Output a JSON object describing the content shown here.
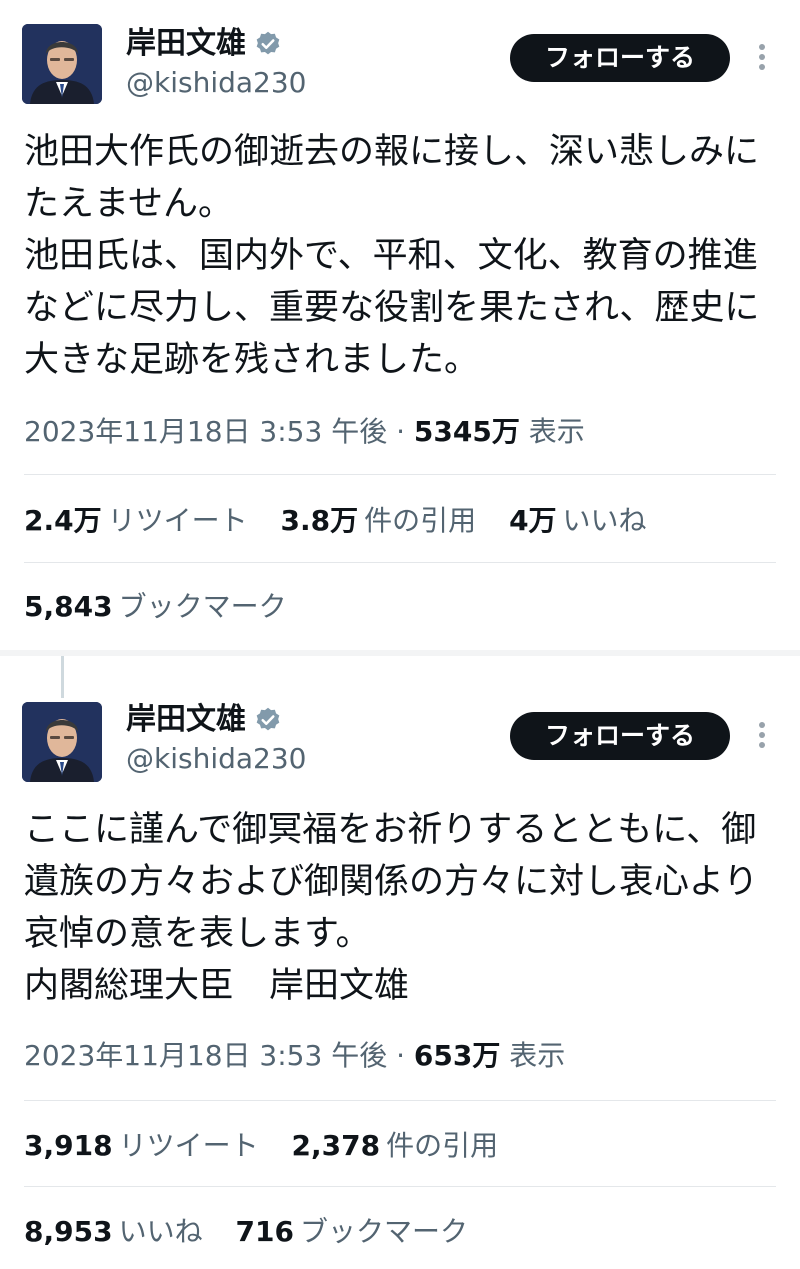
{
  "tweet1": {
    "author_name": "岸田文雄",
    "handle": "@kishida230",
    "follow_label": "フォローする",
    "text": "池田大作氏の御逝去の報に接し、深い悲しみにたえません。\n池田氏は、国内外で、平和、文化、教育の推進などに尽力し、重要な役割を果たされ、歴史に大きな足跡を残されました。",
    "timestamp": "2023年11月18日 3:53 午後",
    "dot": "·",
    "views": "5345万",
    "views_label": "表示",
    "retweets": "2.4万",
    "retweets_label": "リツイート",
    "quotes": "3.8万",
    "quotes_label": "件の引用",
    "likes": "4万",
    "likes_label": "いいね",
    "bookmarks": "5,843",
    "bookmarks_label": "ブックマーク"
  },
  "tweet2": {
    "author_name": "岸田文雄",
    "handle": "@kishida230",
    "follow_label": "フォローする",
    "text": "ここに謹んで御冥福をお祈りするとともに、御遺族の方々および御関係の方々に対し衷心より哀悼の意を表します。\n内閣総理大臣　岸田文雄",
    "timestamp": "2023年11月18日 3:53 午後",
    "dot": "·",
    "views": "653万",
    "views_label": "表示",
    "retweets": "3,918",
    "retweets_label": "リツイート",
    "quotes": "2,378",
    "quotes_label": "件の引用",
    "likes": "8,953",
    "likes_label": "いいね",
    "bookmarks": "716",
    "bookmarks_label": "ブックマーク"
  },
  "colors": {
    "text": "#0f1419",
    "secondary": "#536471",
    "button_bg": "#0f1419",
    "verified_badge": "#829aab"
  },
  "icons": [
    "verified-badge-icon",
    "more-options-icon"
  ]
}
